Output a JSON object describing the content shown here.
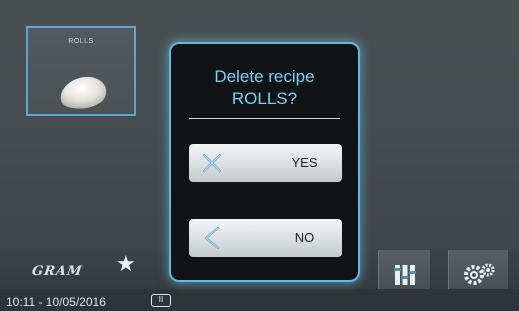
{
  "recipe_tile": {
    "label": "ROLLS"
  },
  "dialog": {
    "title_line1": "Delete recipe",
    "title_line2": "ROLLS?",
    "yes_label": "YES",
    "no_label": "NO"
  },
  "bottom_bar": {
    "logo_text": "GRAM",
    "datetime": "10:11 - 10/05/2016",
    "pause_icon_glyph": "II"
  },
  "icons": [
    "photo-rolls",
    "star-icon",
    "pause-icon",
    "close-x-icon",
    "back-arrow-icon",
    "equalizer-icon",
    "gears-icon"
  ],
  "colors": {
    "accent": "#66b8e0",
    "title": "#7fcff2",
    "dialog_bg": "#101417"
  }
}
